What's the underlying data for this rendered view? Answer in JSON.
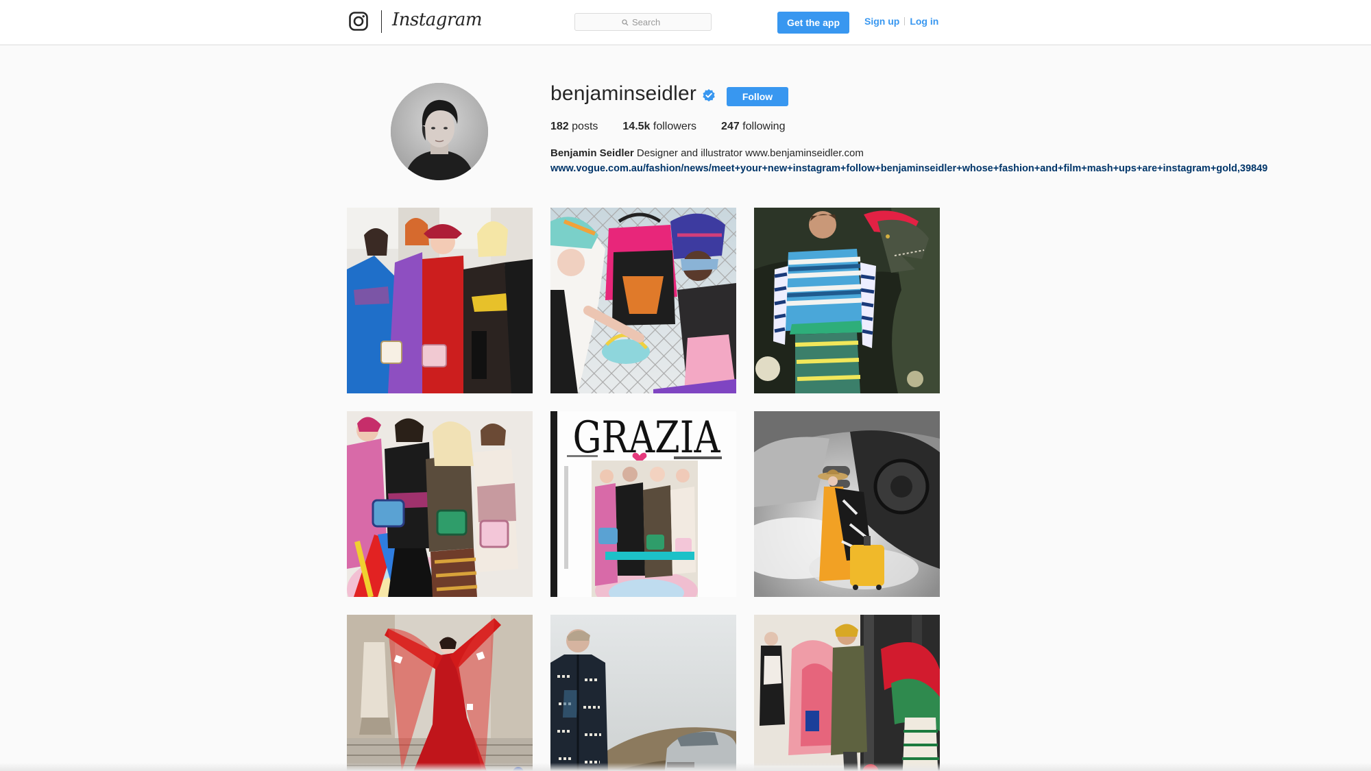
{
  "header": {
    "brand": "Instagram",
    "logo_icon": "instagram-camera-icon",
    "search_placeholder": "Search",
    "get_app_label": "Get the app",
    "signup_label": "Sign up",
    "login_label": "Log in"
  },
  "profile": {
    "username": "benjaminseidler",
    "verified_icon": "verified-badge-icon",
    "follow_label": "Follow",
    "stats": {
      "posts_count": "182",
      "posts_label": "posts",
      "followers_count": "14.5k",
      "followers_label": "followers",
      "following_count": "247",
      "following_label": "following"
    },
    "full_name": "Benjamin Seidler",
    "bio_text": "Designer and illustrator www.benjaminseidler.com",
    "bio_link": "www.vogue.com.au/fashion/news/meet+your+new+instagram+follow+benjaminseidler+whose+fashion+and+film+mash+ups+are+instagram+gold,39849"
  },
  "posts": [
    {
      "name": "post-group-colorful-dresses"
    },
    {
      "name": "post-backpack-chainlink-fence"
    },
    {
      "name": "post-man-with-dinosaur"
    },
    {
      "name": "post-group-gucci-bags"
    },
    {
      "name": "post-grazia-cover",
      "cover_text": "GRAZIA"
    },
    {
      "name": "post-yellow-coat-train"
    },
    {
      "name": "post-red-gown-stairs"
    },
    {
      "name": "post-man-aston-martin"
    },
    {
      "name": "post-face-lift-collage"
    }
  ],
  "colors": {
    "accent": "#3897f0",
    "link": "#003569",
    "background": "#fafafa"
  }
}
